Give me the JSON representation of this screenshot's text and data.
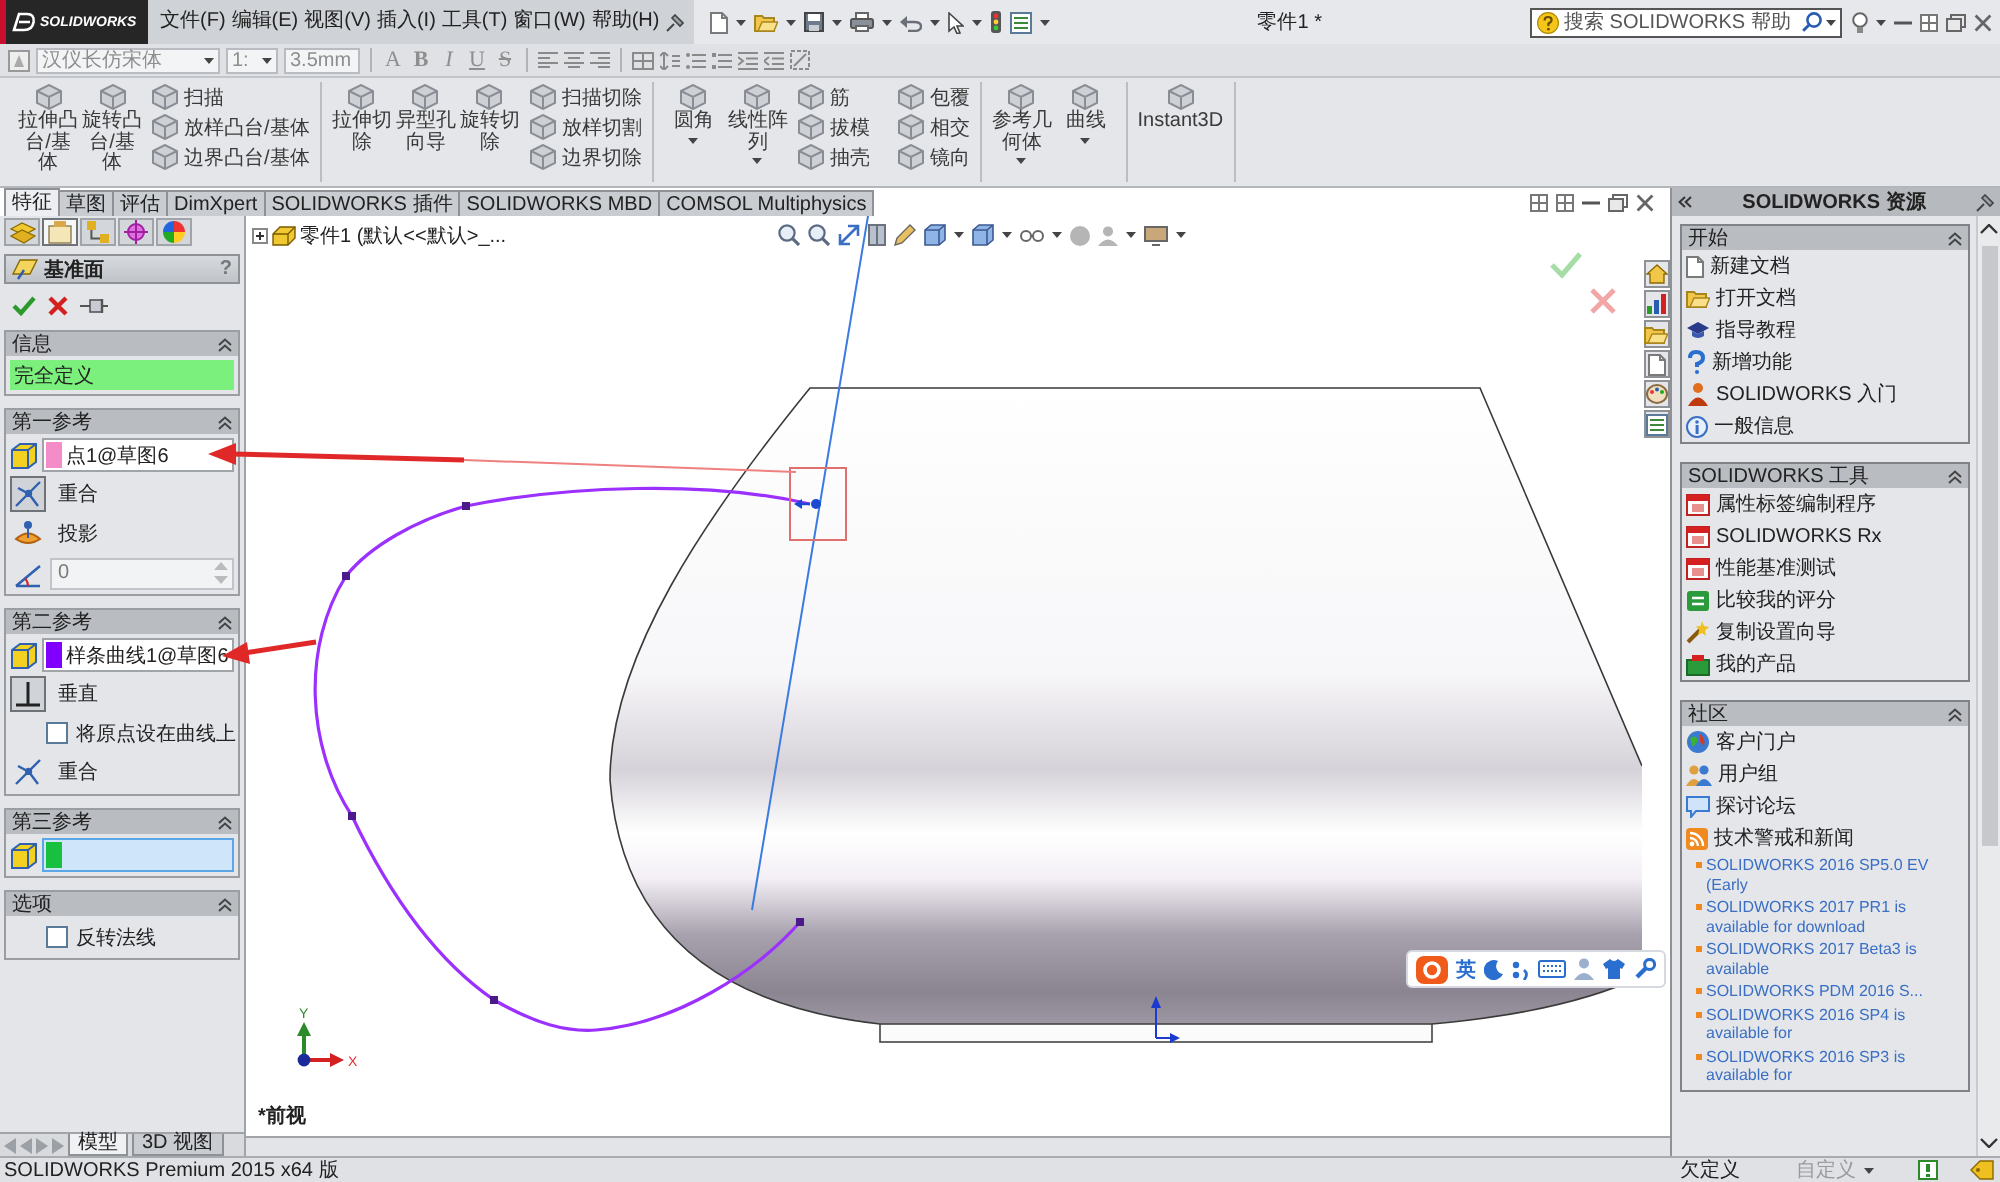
{
  "title_bar": {
    "logo": "SOLIDWORKS",
    "menus": [
      "文件(F)",
      "编辑(E)",
      "视图(V)",
      "插入(I)",
      "工具(T)",
      "窗口(W)",
      "帮助(H)"
    ],
    "document_title": "零件1 *",
    "search": {
      "placeholder": "搜索 SOLIDWORKS 帮助"
    }
  },
  "format_bar": {
    "disabled": true,
    "font": "汉仪长仿宋体",
    "size": "1:",
    "height": "3.5mm",
    "styles": [
      {
        "label": "A",
        "kind": "plain"
      },
      {
        "label": "B",
        "kind": "bold"
      },
      {
        "label": "I",
        "kind": "italic"
      },
      {
        "label": "U",
        "kind": "underline"
      },
      {
        "label": "S",
        "kind": "strike"
      }
    ]
  },
  "ribbon": {
    "groups": [
      {
        "large": [
          {
            "label": "拉伸凸台/基体",
            "dropdown": false
          },
          {
            "label": "旋转凸台/基体",
            "dropdown": false
          }
        ],
        "small": [
          "扫描",
          "放样凸台/基体",
          "边界凸台/基体"
        ]
      },
      {
        "large": [
          {
            "label": "拉伸切除",
            "dropdown": false
          },
          {
            "label": "异型孔向导",
            "dropdown": false
          },
          {
            "label": "旋转切除",
            "dropdown": false
          }
        ],
        "small": [
          "扫描切除",
          "放样切割",
          "边界切除"
        ]
      },
      {
        "large": [
          {
            "label": "圆角",
            "dropdown": true
          },
          {
            "label": "线性阵列",
            "dropdown": true
          }
        ],
        "small": [
          "筋",
          "拔模",
          "抽壳",
          "包覆",
          "相交",
          "镜向"
        ]
      },
      {
        "large": [
          {
            "label": "参考几何体",
            "dropdown": true
          },
          {
            "label": "曲线",
            "dropdown": true
          }
        ]
      },
      {
        "large": [
          {
            "label": "Instant3D",
            "dropdown": false
          }
        ]
      }
    ]
  },
  "tabs": [
    {
      "label": "特征",
      "selected": true
    },
    {
      "label": "草图",
      "selected": false
    },
    {
      "label": "评估",
      "selected": false
    },
    {
      "label": "DimXpert",
      "selected": false
    },
    {
      "label": "SOLIDWORKS 插件",
      "selected": false
    },
    {
      "label": "SOLIDWORKS MBD",
      "selected": false
    },
    {
      "label": "COMSOL Multiphysics",
      "selected": false
    }
  ],
  "property_manager": {
    "panel_tabs": [
      {
        "selected": false
      },
      {
        "selected": true
      },
      {
        "selected": false
      },
      {
        "selected": false
      },
      {
        "selected": false
      }
    ],
    "title": "基准面",
    "help": "?",
    "sections": [
      {
        "title": "信息",
        "kind": "info",
        "status": "完全定义"
      },
      {
        "title": "第一参考",
        "kind": "reference",
        "selection": {
          "value": "点1@草图6",
          "color": "#f48cc8",
          "active": false
        },
        "rows": [
          {
            "kind": "toggle",
            "label": "重合",
            "selected": true
          },
          {
            "kind": "toggle",
            "label": "投影",
            "selected": false
          },
          {
            "kind": "spin",
            "value": "0",
            "disabled": true
          }
        ]
      },
      {
        "title": "第二参考",
        "kind": "reference",
        "selection": {
          "value": "样条曲线1@草图6",
          "color": "#8000ff",
          "active": false
        },
        "rows": [
          {
            "kind": "toggle",
            "label": "垂直",
            "selected": true
          },
          {
            "kind": "checkbox",
            "label": "将原点设在曲线上",
            "checked": false
          },
          {
            "kind": "toggle",
            "label": "重合",
            "selected": false
          }
        ]
      },
      {
        "title": "第三参考",
        "kind": "reference",
        "selection": {
          "color": "#18c040",
          "active": true
        }
      },
      {
        "title": "选项",
        "kind": "options",
        "rows": [
          {
            "kind": "checkbox",
            "label": "反转法线",
            "checked": false
          }
        ]
      }
    ]
  },
  "viewport": {
    "tree_item": "零件1 (默认<<默认>_...",
    "axis_labels": [
      "X",
      "Y"
    ],
    "view_name": "*前视"
  },
  "bottom_tabs": [
    {
      "label": "模型",
      "selected": true
    },
    {
      "label": "3D 视图",
      "selected": false
    }
  ],
  "task_pane": {
    "title": "SOLIDWORKS 资源",
    "sections": [
      {
        "title": "开始",
        "items": [
          "新建文档",
          "打开文档",
          "指导教程",
          "新增功能",
          "SOLIDWORKS 入门",
          "一般信息"
        ]
      },
      {
        "title": "SOLIDWORKS 工具",
        "items": [
          "属性标签编制程序",
          "SOLIDWORKS Rx",
          "性能基准测试",
          "比较我的评分",
          "复制设置向导",
          "我的产品"
        ]
      },
      {
        "title": "社区",
        "items": [
          "客户门户",
          "用户组",
          "探讨论坛",
          "技术警戒和新闻"
        ],
        "news": [
          "SOLIDWORKS 2016 SP5.0 EV (Early",
          "SOLIDWORKS 2017 PR1 is available for download",
          "SOLIDWORKS 2017 Beta3 is available",
          "SOLIDWORKS PDM 2016 S...",
          "SOLIDWORKS 2016 SP4 is available for",
          "SOLIDWORKS 2016 SP3 is available for"
        ]
      }
    ]
  },
  "ime_bar": {
    "mode": "英"
  },
  "status_bar": {
    "product": "SOLIDWORKS Premium 2015 x64 版",
    "sketch_state": "欠定义",
    "units": "自定义"
  }
}
